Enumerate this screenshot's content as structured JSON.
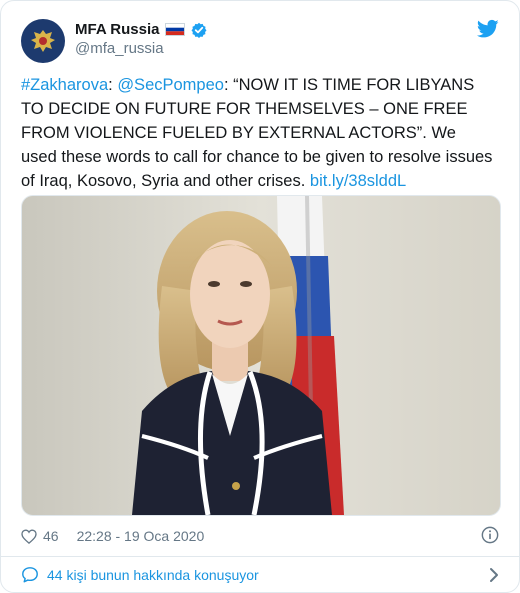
{
  "account": {
    "display_name": "MFA Russia",
    "handle": "@mfa_russia",
    "flag_icon": "russia-flag-icon",
    "verified_icon": "verified-badge-icon"
  },
  "tweet": {
    "hashtag": "#Zakharova",
    "sep1": ": ",
    "mention": "@SecPompeo",
    "body": ": “NOW IT IS TIME FOR LIBYANS TO DECIDE ON FUTURE FOR THEMSELVES – ONE FREE FROM VIOLENCE FUELED BY EXTERNAL ACTORS”. We used these words to call for chance to be given to resolve issues of Iraq, Kosovo, Syria and other crises. ",
    "link": "bit.ly/38slddL"
  },
  "meta": {
    "likes": "46",
    "timestamp": "22:28 - 19 Oca 2020"
  },
  "conversation": {
    "label": "44 kişi bunun hakkında konuşuyor"
  },
  "colors": {
    "link": "#1b95e0",
    "muted": "#657786",
    "border": "#e1e8ed"
  }
}
